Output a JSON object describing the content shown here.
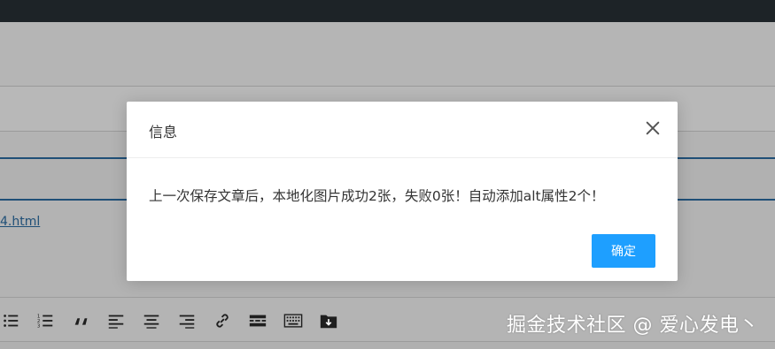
{
  "background": {
    "link_fragment": "4.html",
    "toolbar_icons": [
      "bulleted-list-icon",
      "numbered-list-icon",
      "quote-icon",
      "align-left-icon",
      "align-center-icon",
      "align-right-icon",
      "link-icon",
      "read-more-icon",
      "keyboard-icon",
      "folder-download-icon"
    ]
  },
  "dialog": {
    "title": "信息",
    "message": "上一次保存文章后，本地化图片成功2张，失败0张！自动添加alt属性2个！",
    "ok_label": "确定",
    "close_icon": "close-icon"
  },
  "watermark": "掘金技术社区 @ 爱心发电丶",
  "colors": {
    "topbar": "#1d2327",
    "primary_button": "#1e9fff",
    "overlay_gray": "#b3b3b3"
  }
}
